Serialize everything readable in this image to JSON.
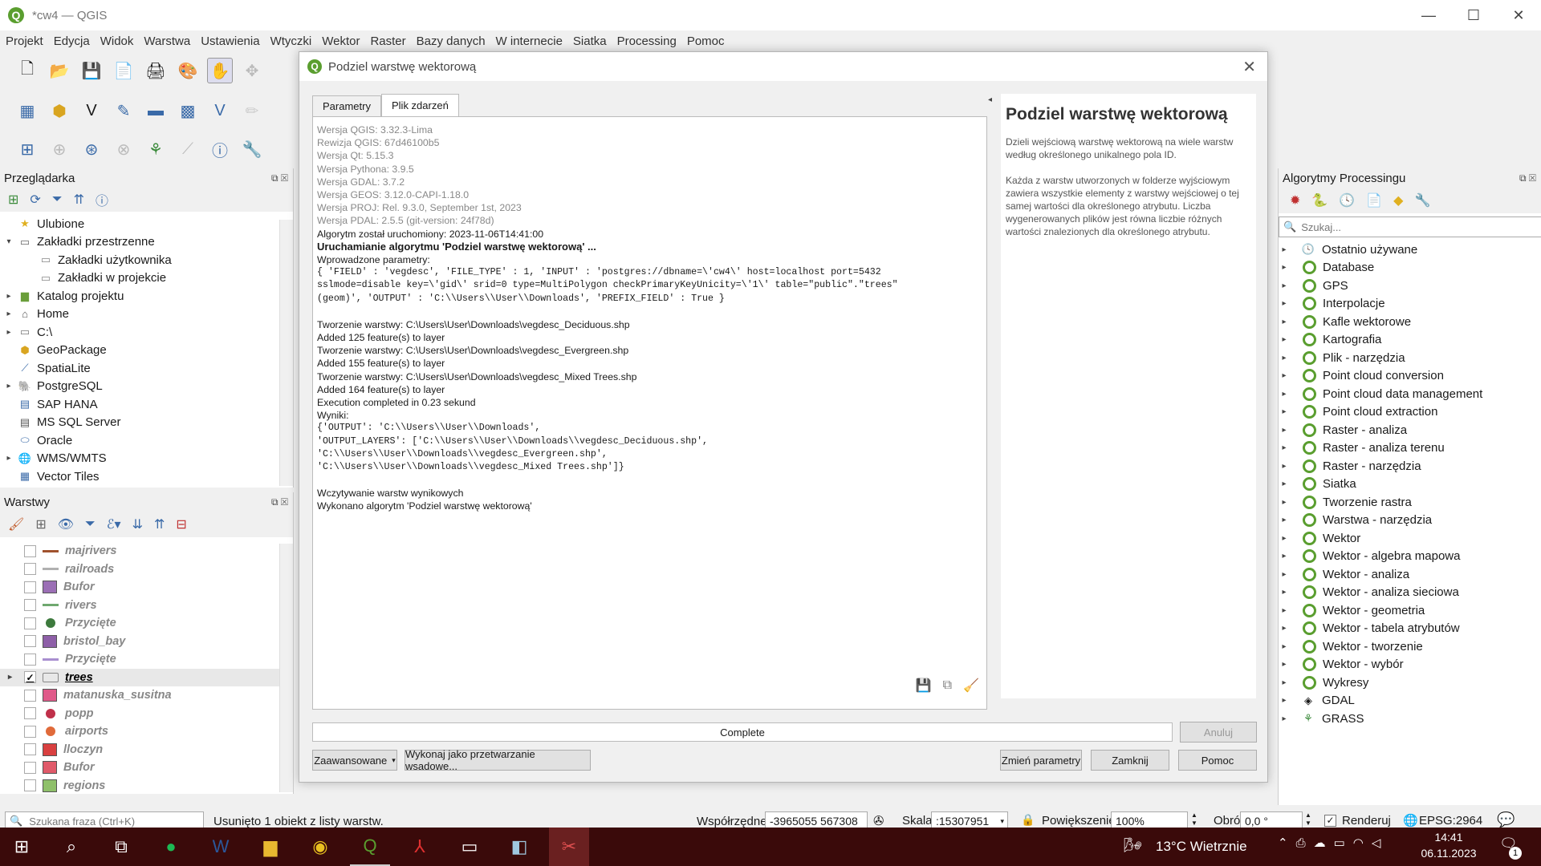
{
  "window": {
    "title": "*cw4 — QGIS"
  },
  "menu": [
    "Projekt",
    "Edycja",
    "Widok",
    "Warstwa",
    "Ustawienia",
    "Wtyczki",
    "Wektor",
    "Raster",
    "Bazy danych",
    "W internecie",
    "Siatka",
    "Processing",
    "Pomoc"
  ],
  "browser": {
    "title": "Przeglądarka",
    "items": [
      {
        "label": "Ulubione",
        "icon": "star-icon",
        "arrow": ""
      },
      {
        "label": "Zakładki przestrzenne",
        "icon": "bookmark-icon",
        "arrow": "▾"
      },
      {
        "label": "Zakładki użytkownika",
        "icon": "folder-icon",
        "arrow": "",
        "indent": true
      },
      {
        "label": "Zakładki w projekcie",
        "icon": "folder-icon",
        "arrow": "",
        "indent": true
      },
      {
        "label": "Katalog projektu",
        "icon": "project-folder-icon",
        "arrow": "▸"
      },
      {
        "label": "Home",
        "icon": "home-icon",
        "arrow": "▸"
      },
      {
        "label": "C:\\",
        "icon": "drive-icon",
        "arrow": "▸"
      },
      {
        "label": "GeoPackage",
        "icon": "geopackage-icon",
        "arrow": ""
      },
      {
        "label": "SpatiaLite",
        "icon": "spatialite-icon",
        "arrow": ""
      },
      {
        "label": "PostgreSQL",
        "icon": "postgresql-icon",
        "arrow": "▸"
      },
      {
        "label": "SAP HANA",
        "icon": "sap-hana-icon",
        "arrow": ""
      },
      {
        "label": "MS SQL Server",
        "icon": "mssql-icon",
        "arrow": ""
      },
      {
        "label": "Oracle",
        "icon": "oracle-icon",
        "arrow": ""
      },
      {
        "label": "WMS/WMTS",
        "icon": "globe-icon",
        "arrow": "▸"
      },
      {
        "label": "Vector Tiles",
        "icon": "grid-icon",
        "arrow": ""
      }
    ]
  },
  "layers": {
    "title": "Warstwy",
    "items": [
      {
        "label": "majrivers",
        "sym": "line",
        "color": "#a0522d",
        "checked": false
      },
      {
        "label": "railroads",
        "sym": "line",
        "color": "#b0b0b0",
        "checked": false
      },
      {
        "label": "Bufor",
        "sym": "fill",
        "color": "#9b6fb5",
        "checked": false
      },
      {
        "label": "rivers",
        "sym": "line",
        "color": "#6fa86f",
        "checked": false
      },
      {
        "label": "Przycięte",
        "sym": "point",
        "color": "#3d7a3d",
        "checked": false
      },
      {
        "label": "bristol_bay",
        "sym": "fill",
        "color": "#8e5fa8",
        "checked": false
      },
      {
        "label": "Przycięte",
        "sym": "line",
        "color": "#a98fd0",
        "checked": false
      },
      {
        "label": "trees",
        "sym": "polygon-outline",
        "color": "#888888",
        "checked": true,
        "active": true
      },
      {
        "label": "matanuska_susitna",
        "sym": "fill",
        "color": "#e05a8a",
        "checked": false
      },
      {
        "label": "popp",
        "sym": "point",
        "color": "#c0304a",
        "checked": false
      },
      {
        "label": "airports",
        "sym": "point",
        "color": "#e06a3a",
        "checked": false
      },
      {
        "label": "lloczyn",
        "sym": "fill",
        "color": "#d94040",
        "checked": false
      },
      {
        "label": "Bufor",
        "sym": "fill",
        "color": "#e05a6a",
        "checked": false
      },
      {
        "label": "regions",
        "sym": "fill",
        "color": "#8fc06a",
        "checked": false
      }
    ]
  },
  "dialog": {
    "title": "Podziel warstwę wektorową",
    "tabs": [
      "Parametry",
      "Plik zdarzeń"
    ],
    "log": {
      "gray": [
        "Wersja QGIS: 3.32.3-Lima",
        "Rewizja QGIS: 67d46100b5",
        "Wersja Qt: 5.15.3",
        "Wersja Pythona: 3.9.5",
        "Wersja GDAL: 3.7.2",
        "Wersja GEOS: 3.12.0-CAPI-1.18.0",
        "Wersja PROJ: Rel. 9.3.0, September 1st, 2023",
        "Wersja PDAL: 2.5.5 (git-version: 24f78d)"
      ],
      "started": "Algorytm został uruchomiony: 2023-11-06T14:41:00",
      "running": "Uruchamianie algorytmu 'Podziel warstwę wektorową' ...",
      "params_label": "Wprowadzone parametry:",
      "params": [
        "{ 'FIELD' : 'vegdesc', 'FILE_TYPE' : 1, 'INPUT' : 'postgres://dbname=\\'cw4\\' host=localhost port=5432",
        "sslmode=disable key=\\'gid\\' srid=0 type=MultiPolygon checkPrimaryKeyUnicity=\\'1\\' table=\"public\".\"trees\"",
        "(geom)', 'OUTPUT' : 'C:\\\\Users\\\\User\\\\Downloads', 'PREFIX_FIELD' : True }"
      ],
      "steps": [
        "Tworzenie warstwy: C:\\Users\\User\\Downloads\\vegdesc_Deciduous.shp",
        "Added 125 feature(s) to layer",
        "Tworzenie warstwy: C:\\Users\\User\\Downloads\\vegdesc_Evergreen.shp",
        "Added 155 feature(s) to layer",
        "Tworzenie warstwy: C:\\Users\\User\\Downloads\\vegdesc_Mixed Trees.shp",
        "Added 164 feature(s) to layer",
        "Execution completed in 0.23 sekund",
        "Wyniki:"
      ],
      "results": [
        "{'OUTPUT': 'C:\\\\Users\\\\User\\\\Downloads',",
        "'OUTPUT_LAYERS': ['C:\\\\Users\\\\User\\\\Downloads\\\\vegdesc_Deciduous.shp',",
        "'C:\\\\Users\\\\User\\\\Downloads\\\\vegdesc_Evergreen.shp',",
        "'C:\\\\Users\\\\User\\\\Downloads\\\\vegdesc_Mixed Trees.shp']}"
      ],
      "loading": "Wczytywanie warstw wynikowych",
      "done": "Wykonano algorytm 'Podziel warstwę wektorową'"
    },
    "help": {
      "title": "Podziel warstwę wektorową",
      "p1": "Dzieli wejściową warstwę wektorową na wiele warstw według określonego unikalnego pola ID.",
      "p2": "Każda z warstw utworzonych w folderze wyjściowym zawiera wszystkie elementy z warstwy wejściowej o tej samej wartości dla określonego atrybutu. Liczba wygenerowanych plików jest równa liczbie różnych wartości znalezionych dla określonego atrybutu."
    },
    "progress": {
      "label": "Complete",
      "value": 1.0
    },
    "buttons": {
      "cancel": "Anuluj",
      "advanced": "Zaawansowane",
      "batch": "Wykonaj jako przetwarzanie wsadowe...",
      "change": "Zmień parametry",
      "close": "Zamknij",
      "help": "Pomoc"
    }
  },
  "processing": {
    "title": "Algorytmy Processingu",
    "search_placeholder": "Szukaj...",
    "items": [
      "Ostatnio używane",
      "Database",
      "GPS",
      "Interpolacje",
      "Kafle wektorowe",
      "Kartografia",
      "Plik - narzędzia",
      "Point cloud conversion",
      "Point cloud data management",
      "Point cloud extraction",
      "Raster - analiza",
      "Raster - analiza terenu",
      "Raster - narzędzia",
      "Siatka",
      "Tworzenie rastra",
      "Warstwa - narzędzia",
      "Wektor",
      "Wektor - algebra mapowa",
      "Wektor - analiza",
      "Wektor - analiza sieciowa",
      "Wektor - geometria",
      "Wektor - tabela atrybutów",
      "Wektor - tworzenie",
      "Wektor - wybór",
      "Wykresy",
      "GDAL",
      "GRASS"
    ]
  },
  "status": {
    "search_placeholder": "Szukana fraza (Ctrl+K)",
    "message": "Usunięto 1 obiekt z listy warstw.",
    "coord_label": "Współrzędne",
    "coord_value": "-3965055  567308",
    "scale_label": "Skala",
    "scale_value": ":15307951",
    "zoom_label": "Powiększenie",
    "zoom_value": "100%",
    "rotation_label": "Obrót",
    "rotation_value": "0,0 °",
    "render_label": "Renderuj",
    "crs": "EPSG:2964"
  },
  "taskbar": {
    "weather": "13°C  Wietrznie",
    "time": "14:41",
    "date": "06.11.2023",
    "notif": "1"
  }
}
